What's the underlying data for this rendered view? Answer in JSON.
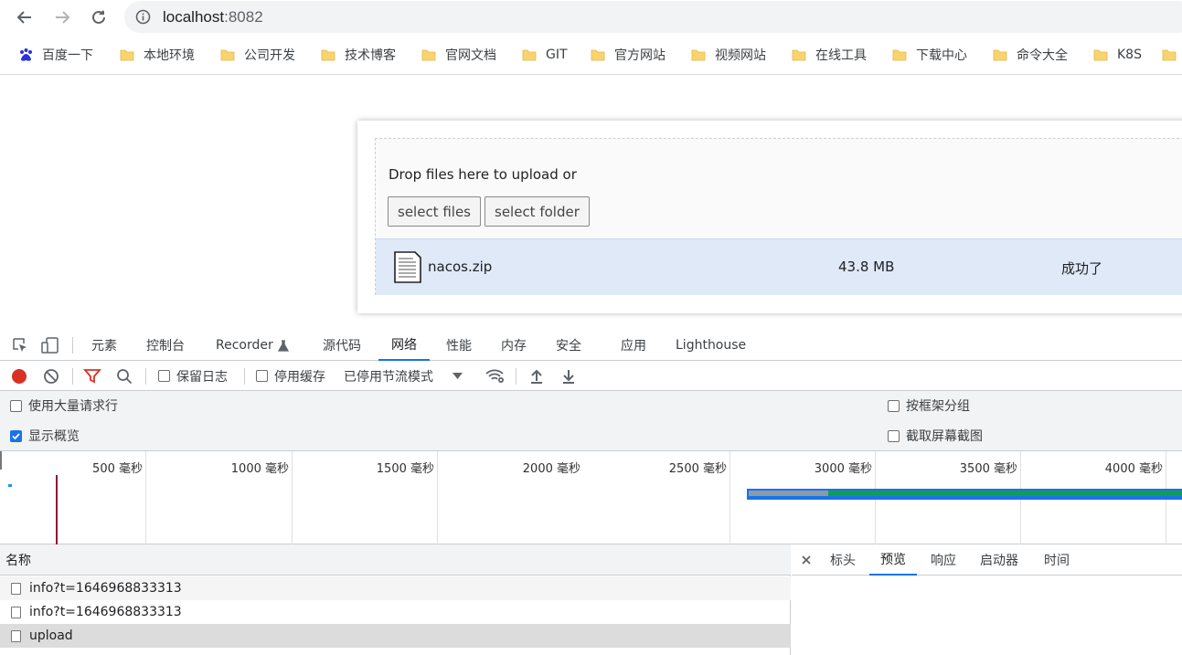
{
  "browser": {
    "url_host": "localhost",
    "url_port": ":8082"
  },
  "bookmarks": [
    {
      "label": "百度一下",
      "icon": "baidu-icon"
    },
    {
      "label": "本地环境",
      "icon": "folder-icon"
    },
    {
      "label": "公司开发",
      "icon": "folder-icon"
    },
    {
      "label": "技术博客",
      "icon": "folder-icon"
    },
    {
      "label": "官网文档",
      "icon": "folder-icon"
    },
    {
      "label": "GIT",
      "icon": "folder-icon"
    },
    {
      "label": "官方网站",
      "icon": "folder-icon"
    },
    {
      "label": "视频网站",
      "icon": "folder-icon"
    },
    {
      "label": "在线工具",
      "icon": "folder-icon"
    },
    {
      "label": "下载中心",
      "icon": "folder-icon"
    },
    {
      "label": "命令大全",
      "icon": "folder-icon"
    },
    {
      "label": "K8S",
      "icon": "folder-icon"
    }
  ],
  "uploader": {
    "drop_text": "Drop files here to upload or",
    "select_files": "select files",
    "select_folder": "select folder",
    "file": {
      "name": "nacos.zip",
      "size": "43.8 MB",
      "status": "成功了"
    }
  },
  "devtools": {
    "tabs": [
      "元素",
      "控制台",
      "Recorder",
      "源代码",
      "网络",
      "性能",
      "内存",
      "安全",
      "应用",
      "Lighthouse"
    ],
    "active_tab": "网络",
    "toolbar": {
      "preserve_log": "保留日志",
      "disable_cache": "停用缓存",
      "throttling": "已停用节流模式"
    },
    "options": {
      "large_rows": "使用大量请求行",
      "show_overview": "显示概览",
      "group_by_frame": "按框架分组",
      "capture_screenshots": "截取屏幕截图"
    },
    "overview_ticks": [
      "500 毫秒",
      "1000 毫秒",
      "1500 毫秒",
      "2000 毫秒",
      "2500 毫秒",
      "3000 毫秒",
      "3500 毫秒",
      "4000 毫秒"
    ],
    "name_header": "名称",
    "requests": [
      "info?t=1646968833313",
      "info?t=1646968833313",
      "upload"
    ],
    "detail_tabs": [
      "标头",
      "预览",
      "响应",
      "启动器",
      "时间"
    ],
    "active_detail_tab": "预览",
    "colors": {
      "accent": "#1a73e8",
      "record": "#d93025",
      "filter": "#d93025"
    }
  }
}
